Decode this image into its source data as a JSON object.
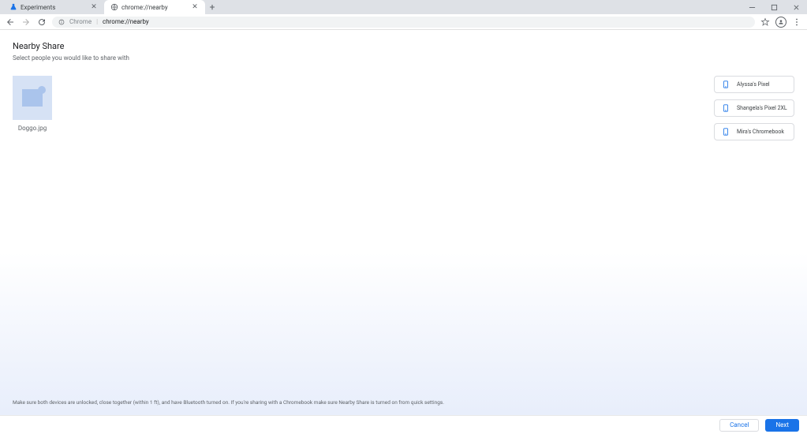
{
  "window": {
    "tabs": [
      {
        "title": "Experiments",
        "active": false
      },
      {
        "title": "chrome://nearby",
        "active": true
      }
    ]
  },
  "omnibox": {
    "prefix": "Chrome",
    "path": "chrome://nearby"
  },
  "page": {
    "title": "Nearby Share",
    "subtitle": "Select people you would like to share with",
    "file": {
      "name": "Doggo.jpg"
    },
    "devices": [
      {
        "name": "Alyssa's Pixel"
      },
      {
        "name": "Shangela's Pixel 2XL"
      },
      {
        "name": "Mira's Chromebook"
      }
    ],
    "hint": "Make sure both devices are unlocked, close together (within 1 ft), and have Bluetooth turned on. If you're sharing with a Chromebook make sure Nearby Share is turned on from quick settings.",
    "footer": {
      "cancel": "Cancel",
      "next": "Next"
    }
  }
}
